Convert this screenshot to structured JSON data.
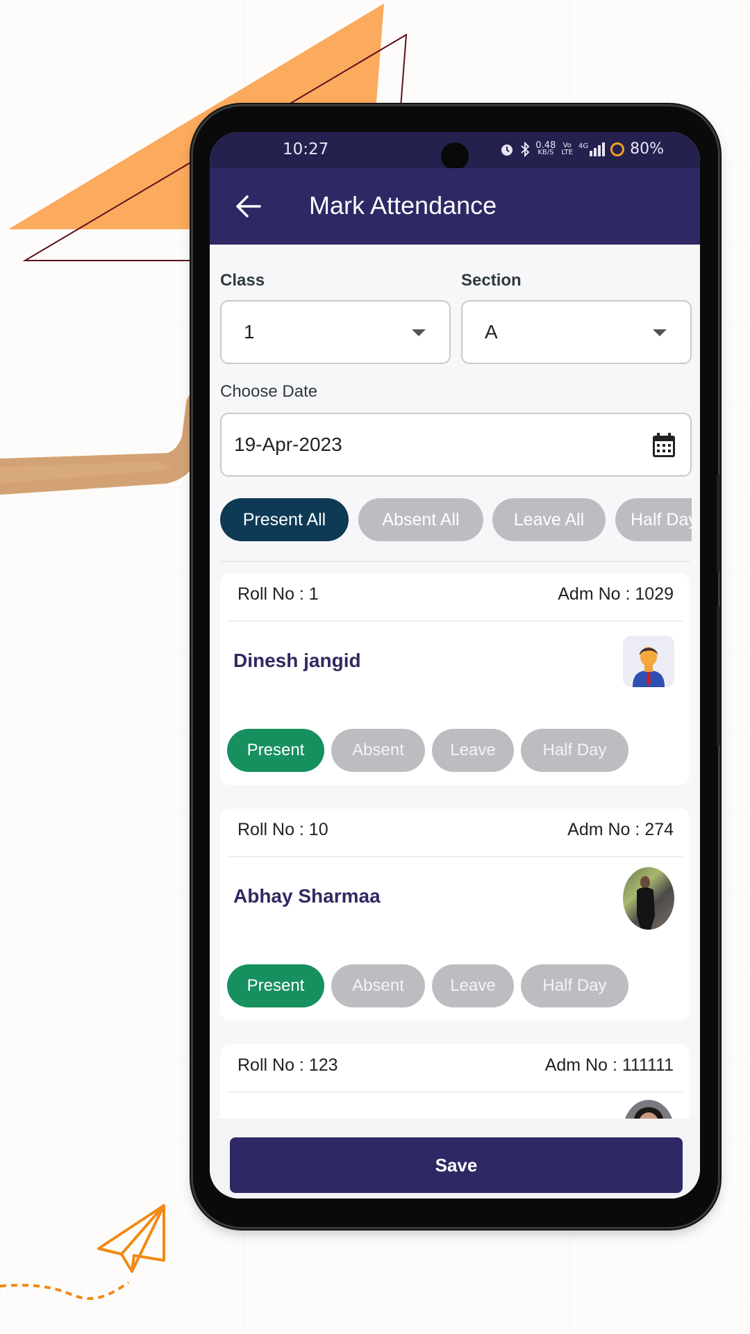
{
  "status_bar": {
    "time": "10:27",
    "net_speed_value": "0.48",
    "net_speed_unit": "KB/S",
    "volte_top": "Vo",
    "volte_bottom": "LTE",
    "network": "4G",
    "battery": "80%",
    "icons": [
      "alarm-icon",
      "bluetooth-icon",
      "signal-icon",
      "battery-saver-icon"
    ]
  },
  "appbar": {
    "back_icon": "arrow-left-icon",
    "title": "Mark Attendance"
  },
  "form": {
    "class_label": "Class",
    "class_value": "1",
    "section_label": "Section",
    "section_value": "A",
    "date_label": "Choose Date",
    "date_value": "19-Apr-2023",
    "date_icon": "calendar-icon"
  },
  "bulk_actions": [
    {
      "label": "Present All",
      "active": true
    },
    {
      "label": "Absent All",
      "active": false
    },
    {
      "label": "Leave All",
      "active": false
    },
    {
      "label": "Half Day All",
      "active": false
    }
  ],
  "students": [
    {
      "roll": "Roll No : 1",
      "adm": "Adm No : 1029",
      "name": "Dinesh jangid",
      "avatar": "default-avatar",
      "status": "Present"
    },
    {
      "roll": "Roll No : 10",
      "adm": "Adm No : 274",
      "name": "Abhay Sharmaa",
      "avatar": "photo-avatar",
      "status": "Present"
    },
    {
      "roll": "Roll No : 123",
      "adm": "Adm No : 111111",
      "name": "",
      "avatar": "photo-avatar",
      "status": ""
    }
  ],
  "status_options": [
    "Present",
    "Absent",
    "Leave",
    "Half Day"
  ],
  "save_label": "Save",
  "colors": {
    "primary": "#2e2865",
    "status_bar": "#24214f",
    "present_all": "#0e3a55",
    "present": "#17905f",
    "inactive": "#bdbcc1",
    "accent_orange": "#fbaa5e"
  }
}
